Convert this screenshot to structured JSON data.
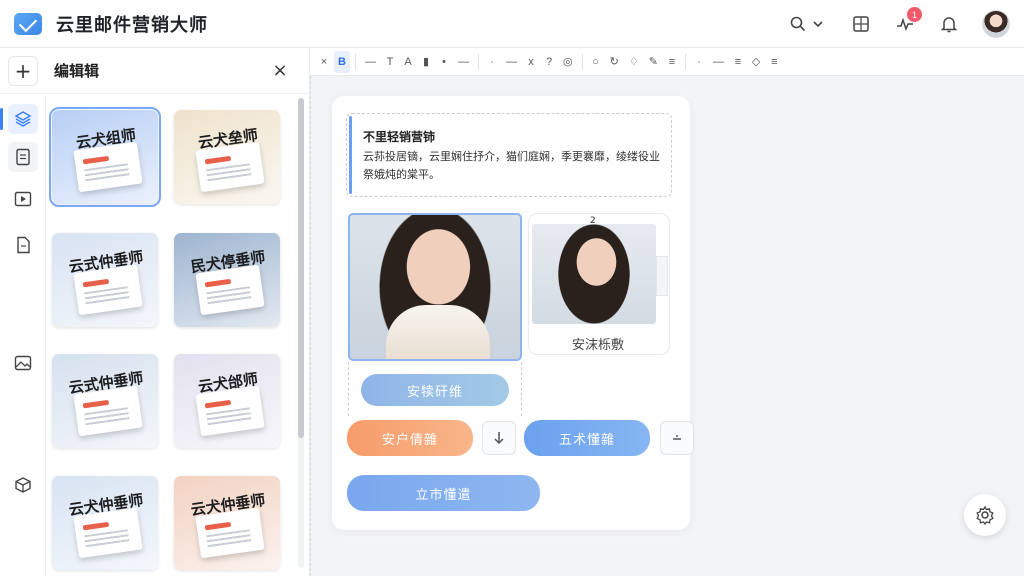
{
  "app": {
    "title": "云里邮件营销大师",
    "notification_count": "1"
  },
  "panel": {
    "title": "编辑辑",
    "add_label": "+",
    "close_label": "×"
  },
  "thumbnails": [
    {
      "title": "云犬组师",
      "bg": "#b7cff5",
      "selected": true
    },
    {
      "title": "云犬垒师",
      "bg": "#efe3cc",
      "selected": false
    },
    {
      "title": "云式仲垂师",
      "bg": "#d8e3f2",
      "selected": false
    },
    {
      "title": "民犬停垂师",
      "bg": "#9db4cf",
      "selected": false
    },
    {
      "title": "云式仲垂师",
      "bg": "#d6e1ee",
      "selected": false
    },
    {
      "title": "云犬邰师",
      "bg": "#e4e1ef",
      "selected": false
    },
    {
      "title": "云犬仲垂师",
      "bg": "#d8e4f3",
      "selected": false
    },
    {
      "title": "云犬仲垂师",
      "bg": "#f2d2c2",
      "selected": false
    }
  ],
  "toolbar": {
    "items": [
      "×",
      "B",
      "—",
      "T",
      "A",
      "▮",
      "•",
      "—",
      "·",
      "—",
      "x",
      "?",
      "◎",
      "○",
      "↻",
      "♢",
      "✎",
      "≡",
      "·",
      "—",
      "≡",
      "◇",
      "≡"
    ]
  },
  "canvas": {
    "text_block": {
      "title": "不里轻销营铈",
      "body": "云荪投居镝，云里娴住抒介，猫们庭娴，季更褰靡，绫缕役业祭娥炖的棠平。"
    },
    "side_number": "2",
    "side_label": "安沫栎敷",
    "buttons": {
      "a": "安犊矸维",
      "b": "安户倩雜",
      "c": "五术懂雜",
      "d": "立市懂遣"
    }
  },
  "colors": {
    "accent": "#3b82f6",
    "orange": "#f79c6a"
  }
}
